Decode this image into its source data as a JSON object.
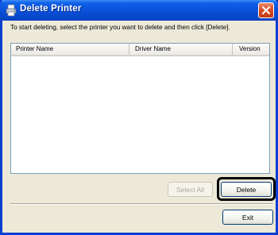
{
  "window": {
    "title": "Delete Printer",
    "title_icon": "printer-icon",
    "close_icon": "close-icon",
    "accent": "#0a4fd8",
    "close_color": "#d84a22"
  },
  "instruction": "To start deleting, select the printer you want to delete and then click [Delete].",
  "list": {
    "columns": [
      "Printer Name",
      "Driver Name",
      "Version"
    ],
    "rows": []
  },
  "buttons": {
    "select_all": "Select All",
    "delete": "Delete",
    "exit": "Exit"
  }
}
